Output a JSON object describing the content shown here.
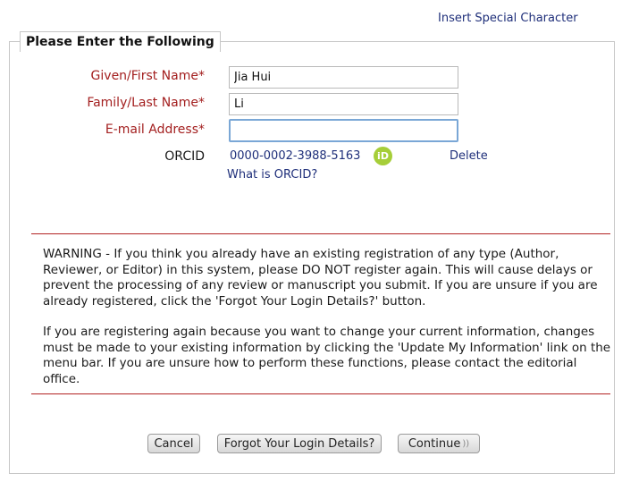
{
  "header": {
    "special_char_link": "Insert Special Character"
  },
  "form": {
    "legend": "Please Enter the Following",
    "given_name": {
      "label": "Given/First Name*",
      "value": "Jia Hui"
    },
    "family_name": {
      "label": "Family/Last Name*",
      "value": "Li"
    },
    "email": {
      "label": "E-mail Address*",
      "value": ""
    },
    "orcid": {
      "label": "ORCID",
      "id": "0000-0002-3988-5163",
      "icon_text": "iD",
      "delete": "Delete",
      "what_is": "What is ORCID?"
    }
  },
  "warning": {
    "paragraph1": "WARNING - If you think you already have an existing registration of any type (Author, Reviewer, or Editor) in this system, please DO NOT register again. This will cause delays or prevent the processing of any review or manuscript you submit. If you are unsure if you are already registered, click the 'Forgot Your Login Details?' button.",
    "paragraph2": "If you are registering again because you want to change your current information, changes must be made to your existing information by clicking the 'Update My Information' link on the menu bar. If you are unsure how to perform these functions, please contact the editorial office."
  },
  "buttons": {
    "cancel": "Cancel",
    "forgot": "Forgot Your Login Details?",
    "continue": "Continue"
  },
  "colors": {
    "label_red": "#a31f1f",
    "link_blue": "#1f2f7a",
    "orcid_green": "#a6ce39",
    "rule_red": "#b22222"
  }
}
